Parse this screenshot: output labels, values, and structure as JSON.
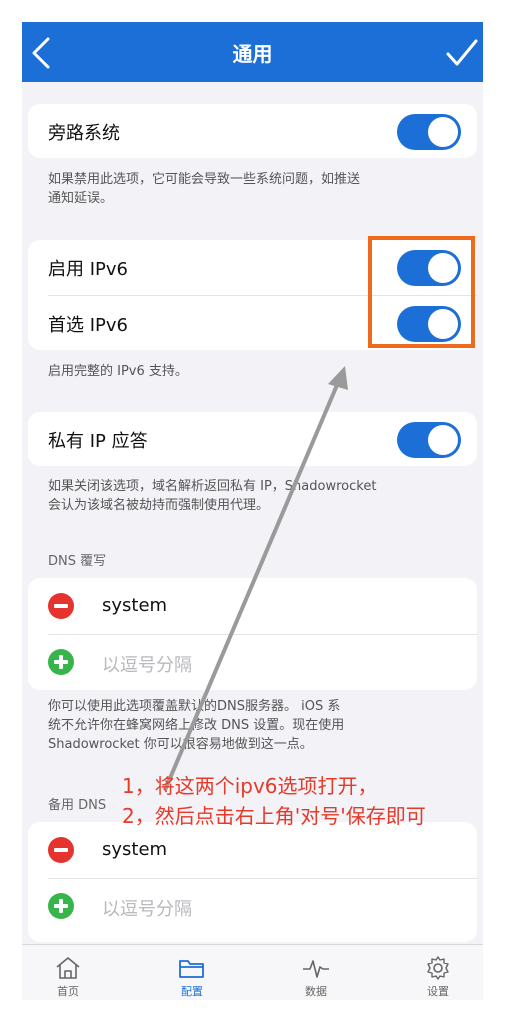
{
  "nav": {
    "title": "通用",
    "back_icon": "chevron-left-icon",
    "confirm_icon": "checkmark-icon"
  },
  "bypass": {
    "label": "旁路系统",
    "enabled": true,
    "footnote_line1": "如果禁用此选项，它可能会导致一些系统问题，如推送",
    "footnote_line2": "通知延误。"
  },
  "ipv6": {
    "enable_label": "启用 IPv6",
    "enable_on": true,
    "prefer_label": "首选 IPv6",
    "prefer_on": true,
    "footnote": "启用完整的 IPv6 支持。"
  },
  "private_ip": {
    "label": "私有 IP 应答",
    "enabled": true,
    "footnote_line1": "如果关闭该选项，域名解析返回私有 IP，Shadowrocket",
    "footnote_line2": "会认为该域名被劫持而强制使用代理。"
  },
  "dns_override": {
    "header": "DNS 覆写",
    "entries": [
      "system"
    ],
    "add_placeholder": "以逗号分隔",
    "footnote_line1": "你可以使用此选项覆盖默认的DNS服务器。 iOS 系",
    "footnote_line2": "统不允许你在蜂窝网络上修改 DNS 设置。现在使用",
    "footnote_line3": "Shadowrocket 你可以很容易地做到这一点。"
  },
  "backup_dns": {
    "header": "备用 DNS",
    "entries": [
      "system"
    ],
    "add_placeholder": "以逗号分隔"
  },
  "tabs": [
    {
      "label": "首页",
      "icon": "home-icon",
      "active": false
    },
    {
      "label": "配置",
      "icon": "folder-icon",
      "active": true
    },
    {
      "label": "数据",
      "icon": "pulse-icon",
      "active": false
    },
    {
      "label": "设置",
      "icon": "gear-icon",
      "active": false
    }
  ],
  "annotation": {
    "line1": "1，将这两个ipv6选项打开，",
    "line2": "2，然后点击右上角'对号'保存即可"
  },
  "colors": {
    "accent": "#1c6fd6",
    "annotation": "#e53a2a",
    "remove": "#e5342f",
    "add": "#38b54a"
  }
}
